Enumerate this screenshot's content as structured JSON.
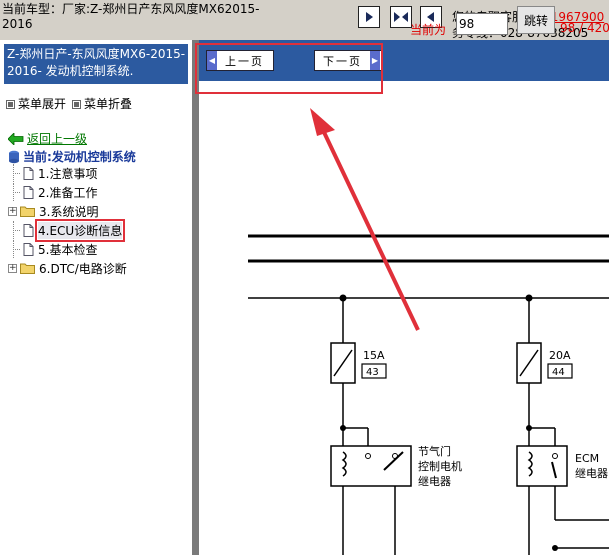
{
  "header": {
    "model_line1": "当前车型：厂家:Z-郑州日产东风风度MX62015-",
    "model_line2": "2016",
    "service_prefix": "您的专职客服",
    "qq": "QQ:1967900",
    "phone": "务专线：028-87038205",
    "nav_icons": [
      "arrow-right-icon",
      "double-arrow-icon",
      "arrow-left-icon"
    ]
  },
  "sidebar": {
    "title": "Z-郑州日产-东风风度MX6-2015-2016- 发动机控制系统.",
    "expand_label": "菜单展开",
    "collapse_label": "菜单折叠",
    "back_label": "返回上一级",
    "current_label": "当前:发动机控制系统",
    "items": [
      {
        "label": "1.注意事项",
        "type": "doc"
      },
      {
        "label": "2.准备工作",
        "type": "doc"
      },
      {
        "label": "3.系统说明",
        "type": "folder"
      },
      {
        "label": "4.ECU诊断信息",
        "type": "doc",
        "highlighted": true
      },
      {
        "label": "5.基本检查",
        "type": "doc"
      },
      {
        "label": "6.DTC/电路诊断",
        "type": "folder"
      }
    ]
  },
  "toolbar": {
    "prev_label": "上一页",
    "next_label": "下一页",
    "current_label": "当前为",
    "page_value": "98",
    "jump_label": "跳转",
    "page_total": "98 / 420"
  },
  "diagram": {
    "fuse1_rating": "15A",
    "fuse1_number": "43",
    "fuse2_rating": "20A",
    "fuse2_number": "44",
    "relay1_label_line1": "节气门",
    "relay1_label_line2": "控制电机",
    "relay1_label_line3": "继电器",
    "relay2_label_line1": "ECM",
    "relay2_label_line2": "继电器"
  },
  "colors": {
    "toolbar_blue": "#2c5aa0",
    "annotation_red": "#e0303a",
    "accent_red": "#e00000",
    "back_green": "#007700"
  }
}
